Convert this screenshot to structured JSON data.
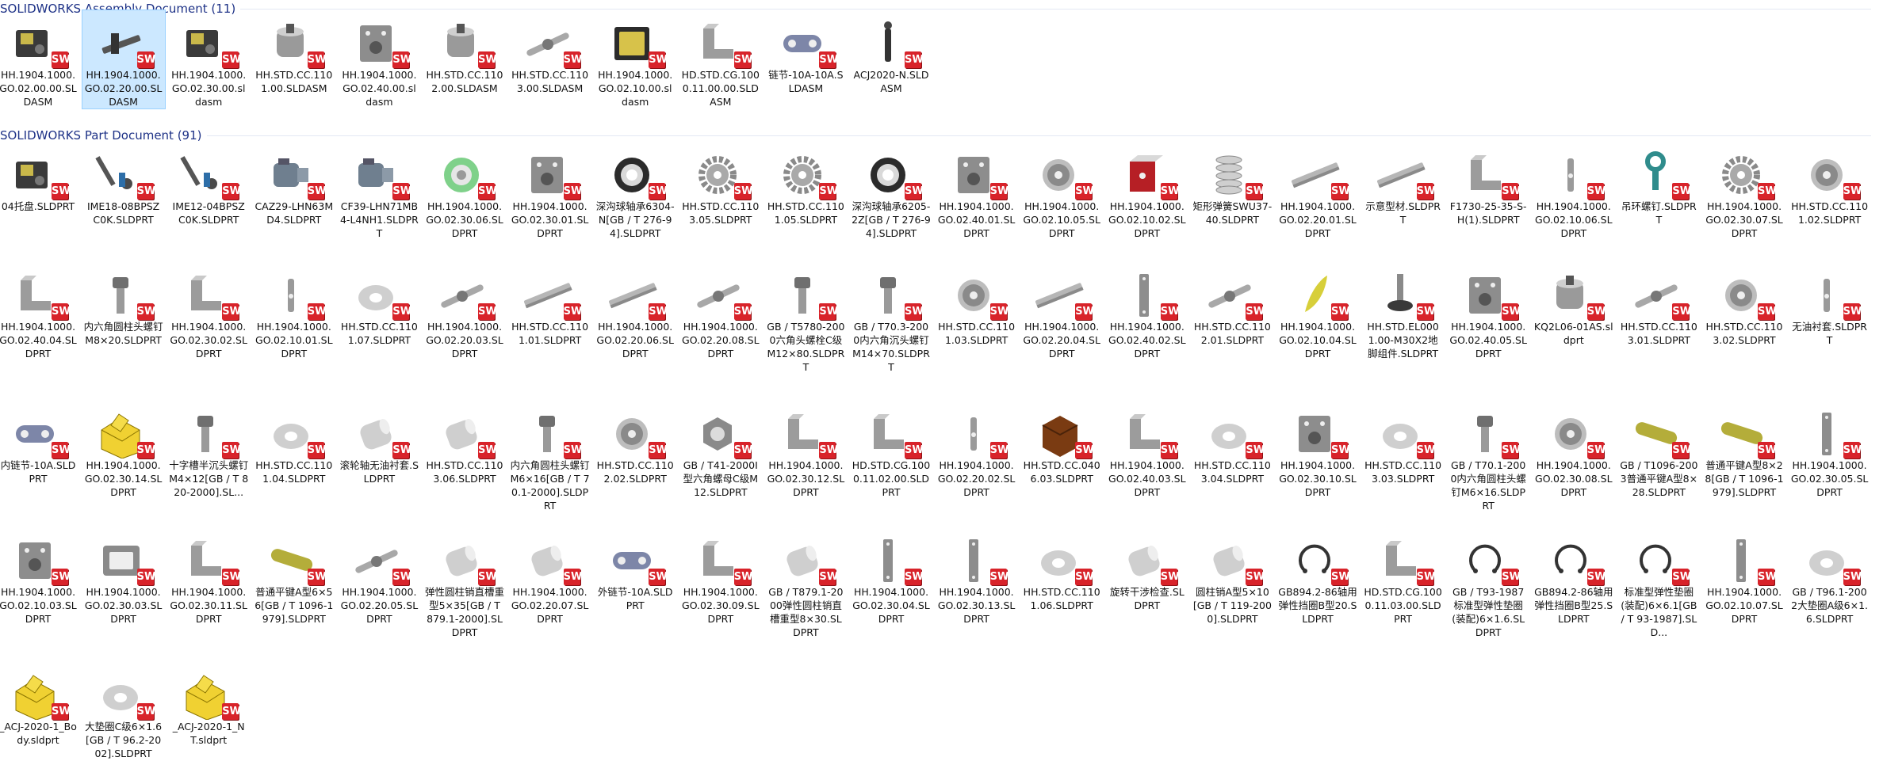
{
  "groups": [
    {
      "title": "SOLIDWORKS Assembly Document (11)",
      "items": [
        {
          "name": "HH.1904.1000.GO.02.00.00.SLDASM",
          "icon": "assembly-dark"
        },
        {
          "name": "HH.1904.1000.GO.02.20.00.SLDASM",
          "icon": "assembly-rail",
          "selected": true
        },
        {
          "name": "HH.1904.1000.GO.02.30.00.sldasm",
          "icon": "assembly-dark"
        },
        {
          "name": "HH.STD.CC.1101.00.SLDASM",
          "icon": "cylinder"
        },
        {
          "name": "HH.1904.1000.GO.02.40.00.sldasm",
          "icon": "plate"
        },
        {
          "name": "HH.STD.CC.1102.00.SLDASM",
          "icon": "cylinder"
        },
        {
          "name": "HH.STD.CC.1103.00.SLDASM",
          "icon": "shaft"
        },
        {
          "name": "HH.1904.1000.GO.02.10.00.sldasm",
          "icon": "assembly-yellow"
        },
        {
          "name": "HD.STD.CG.1000.11.00.00.SLDASM",
          "icon": "bracket"
        },
        {
          "name": "链节-10A-10A.SLDASM",
          "icon": "chainlink"
        },
        {
          "name": "ACJ2020-N.SLDASM",
          "icon": "rod"
        }
      ]
    },
    {
      "title": "SOLIDWORKS Part Document (91)",
      "items": [
        {
          "name": "04托盘.SLDPRT",
          "icon": "assembly-dark"
        },
        {
          "name": "IME18-08BPSZC0K.SLDPRT",
          "icon": "sensor"
        },
        {
          "name": "IME12-04BPSZC0K.SLDPRT",
          "icon": "sensor"
        },
        {
          "name": "CAZ29-LHN63MD4.SLDPRT",
          "icon": "motor"
        },
        {
          "name": "CF39-LHN71MB4-L4NH1.SLDPRT",
          "icon": "motor"
        },
        {
          "name": "HH.1904.1000.GO.02.30.06.SLDPRT",
          "icon": "green-ring"
        },
        {
          "name": "HH.1904.1000.GO.02.30.01.SLDPRT",
          "icon": "plate"
        },
        {
          "name": "深沟球轴承6304-N[GB / T 276-94].SLDPRT",
          "icon": "bearing"
        },
        {
          "name": "HH.STD.CC.1103.05.SLDPRT",
          "icon": "gear"
        },
        {
          "name": "HH.STD.CC.1101.05.SLDPRT",
          "icon": "gear"
        },
        {
          "name": "深沟球轴承6205-2Z[GB / T 276-94].SLDPRT",
          "icon": "bearing"
        },
        {
          "name": "HH.1904.1000.GO.02.40.01.SLDPRT",
          "icon": "plate"
        },
        {
          "name": "HH.1904.1000.GO.02.10.05.SLDPRT",
          "icon": "disc"
        },
        {
          "name": "HH.1904.1000.GO.02.10.02.SLDPRT",
          "icon": "red-bracket"
        },
        {
          "name": "矩形弹簧SWU37-40.SLDPRT",
          "icon": "spring"
        },
        {
          "name": "HH.1904.1000.GO.02.20.01.SLDPRT",
          "icon": "rail"
        },
        {
          "name": "示意型材.SLDPRT",
          "icon": "rail"
        },
        {
          "name": "F1730-25-35-S-H(1).SLDPRT",
          "icon": "bracket"
        },
        {
          "name": "HH.1904.1000.GO.02.10.06.SLDPRT",
          "icon": "pin"
        },
        {
          "name": "吊环螺钉.SLDPRT",
          "icon": "eyebolt"
        },
        {
          "name": "HH.1904.1000.GO.02.30.07.SLDPRT",
          "icon": "gear"
        },
        {
          "name": "HH.STD.CC.1101.02.SLDPRT",
          "icon": "disc"
        },
        {
          "name": "HH.1904.1000.GO.02.40.04.SLDPRT",
          "icon": "bracket"
        },
        {
          "name": "内六角圆柱头螺钉M8×20.SLDPRT",
          "icon": "bolt"
        },
        {
          "name": "HH.1904.1000.GO.02.30.02.SLDPRT",
          "icon": "bracket"
        },
        {
          "name": "HH.1904.1000.GO.02.10.01.SLDPRT",
          "icon": "pin"
        },
        {
          "name": "HH.STD.CC.1101.07.SLDPRT",
          "icon": "washer"
        },
        {
          "name": "HH.1904.1000.GO.02.20.03.SLDPRT",
          "icon": "shaft"
        },
        {
          "name": "HH.STD.CC.1101.01.SLDPRT",
          "icon": "rail"
        },
        {
          "name": "HH.1904.1000.GO.02.20.06.SLDPRT",
          "icon": "rail"
        },
        {
          "name": "HH.1904.1000.GO.02.20.08.SLDPRT",
          "icon": "shaft"
        },
        {
          "name": "GB / T5780-2000六角头螺栓C级M12×80.SLDPRT",
          "icon": "bolt"
        },
        {
          "name": "GB / T70.3-2000内六角沉头螺钉M14×70.SLDPRT",
          "icon": "bolt"
        },
        {
          "name": "HH.STD.CC.1101.03.SLDPRT",
          "icon": "disc"
        },
        {
          "name": "HH.1904.1000.GO.02.20.04.SLDPRT",
          "icon": "rail"
        },
        {
          "name": "HH.1904.1000.GO.02.40.02.SLDPRT",
          "icon": "strip"
        },
        {
          "name": "HH.STD.CC.1102.01.SLDPRT",
          "icon": "shaft"
        },
        {
          "name": "HH.1904.1000.GO.02.10.04.SLDPRT",
          "icon": "yellow-wedge"
        },
        {
          "name": "HH.STD.EL0001.00-M30X2地脚组件.SLDPRT",
          "icon": "foot"
        },
        {
          "name": "HH.1904.1000.GO.02.40.05.SLDPRT",
          "icon": "plate"
        },
        {
          "name": "KQ2L06-01AS.sldprt",
          "icon": "cylinder"
        },
        {
          "name": "HH.STD.CC.1103.01.SLDPRT",
          "icon": "shaft"
        },
        {
          "name": "HH.STD.CC.1103.02.SLDPRT",
          "icon": "disc"
        },
        {
          "name": "无油衬套.SLDPRT",
          "icon": "pin"
        },
        {
          "name": "内链节-10A.SLDPRT",
          "icon": "chainlink"
        },
        {
          "name": "HH.1904.1000.GO.02.30.14.SLDPRT",
          "icon": "yellow-block"
        },
        {
          "name": "十字槽半沉头螺钉M4×12[GB / T 820-2000].SL...",
          "icon": "bolt"
        },
        {
          "name": "HH.STD.CC.1101.04.SLDPRT",
          "icon": "washer"
        },
        {
          "name": "滚轮轴无油衬套.SLDPRT",
          "icon": "tube"
        },
        {
          "name": "HH.STD.CC.1103.06.SLDPRT",
          "icon": "tube"
        },
        {
          "name": "内六角圆柱头螺钉M6×16[GB / T 70.1-2000].SLDPRT",
          "icon": "bolt"
        },
        {
          "name": "HH.STD.CC.1102.02.SLDPRT",
          "icon": "disc"
        },
        {
          "name": "GB / T41-2000I型六角螺母C级M12.SLDPRT",
          "icon": "nut"
        },
        {
          "name": "HH.1904.1000.GO.02.30.12.SLDPRT",
          "icon": "bracket"
        },
        {
          "name": "HD.STD.CG.1000.11.02.00.SLDPRT",
          "icon": "bracket"
        },
        {
          "name": "HH.1904.1000.GO.02.20.02.SLDPRT",
          "icon": "pin"
        },
        {
          "name": "HH.STD.CC.0406.03.SLDPRT",
          "icon": "brown-block"
        },
        {
          "name": "HH.1904.1000.GO.02.40.03.SLDPRT",
          "icon": "bracket"
        },
        {
          "name": "HH.STD.CC.1103.04.SLDPRT",
          "icon": "washer"
        },
        {
          "name": "HH.1904.1000.GO.02.30.10.SLDPRT",
          "icon": "plate"
        },
        {
          "name": "HH.STD.CC.1103.03.SLDPRT",
          "icon": "washer"
        },
        {
          "name": "GB / T70.1-2000内六角圆柱头螺钉M6×16.SLDPRT",
          "icon": "bolt"
        },
        {
          "name": "HH.1904.1000.GO.02.30.08.SLDPRT",
          "icon": "disc"
        },
        {
          "name": "GB / T1096-2003普通平键A型8×28.SLDPRT",
          "icon": "yellow-key"
        },
        {
          "name": "普通平键A型8×28[GB / T 1096-1979].SLDPRT",
          "icon": "yellow-key"
        },
        {
          "name": "HH.1904.1000.GO.02.30.05.SLDPRT",
          "icon": "strip"
        },
        {
          "name": "HH.1904.1000.GO.02.10.03.SLDPRT",
          "icon": "plate"
        },
        {
          "name": "HH.1904.1000.GO.02.30.03.SLDPRT",
          "icon": "frame"
        },
        {
          "name": "HH.1904.1000.GO.02.30.11.SLDPRT",
          "icon": "bracket"
        },
        {
          "name": "普通平键A型6×56[GB / T 1096-1979].SLDPRT",
          "icon": "yellow-key"
        },
        {
          "name": "HH.1904.1000.GO.02.20.05.SLDPRT",
          "icon": "shaft"
        },
        {
          "name": "弹性圆柱销直槽重型5×35[GB / T 879.1-2000].SLDPRT",
          "icon": "tube"
        },
        {
          "name": "HH.1904.1000.GO.02.20.07.SLDPRT",
          "icon": "tube"
        },
        {
          "name": "外链节-10A.SLDPRT",
          "icon": "chainlink"
        },
        {
          "name": "HH.1904.1000.GO.02.30.09.SLDPRT",
          "icon": "bracket"
        },
        {
          "name": "GB / T879.1-2000弹性圆柱销直槽重型8×30.SLDPRT",
          "icon": "tube"
        },
        {
          "name": "HH.1904.1000.GO.02.30.04.SLDPRT",
          "icon": "strip"
        },
        {
          "name": "HH.1904.1000.GO.02.30.13.SLDPRT",
          "icon": "strip"
        },
        {
          "name": "HH.STD.CC.1101.06.SLDPRT",
          "icon": "washer"
        },
        {
          "name": "旋转干涉检查.SLDPRT",
          "icon": "tube"
        },
        {
          "name": "圆柱销A型5×10[GB / T 119-2000].SLDPRT",
          "icon": "tube"
        },
        {
          "name": "GB894.2-86轴用弹性挡圈B型20.SLDPRT",
          "icon": "circlip"
        },
        {
          "name": "HD.STD.CG.1000.11.03.00.SLDPRT",
          "icon": "bracket"
        },
        {
          "name": "GB / T93-1987标准型弹性垫圈(装配)6×1.6.SLDPRT",
          "icon": "circlip"
        },
        {
          "name": "GB894.2-86轴用弹性挡圈B型25.SLDPRT",
          "icon": "circlip"
        },
        {
          "name": "标准型弹性垫圈(装配)6×6.1[GB / T 93-1987].SLD...",
          "icon": "circlip"
        },
        {
          "name": "HH.1904.1000.GO.02.10.07.SLDPRT",
          "icon": "strip"
        },
        {
          "name": "GB / T96.1-2002大垫圈A级6×1.6.SLDPRT",
          "icon": "washer"
        },
        {
          "name": "_ACJ-2020-1_Body.sldprt",
          "icon": "yellow-block"
        },
        {
          "name": "大垫圈C级6×1.6[GB / T 96.2-2002].SLDPRT",
          "icon": "washer"
        },
        {
          "name": "_ACJ-2020-1_NT.sldprt",
          "icon": "yellow-block"
        }
      ]
    }
  ],
  "badge_text": "SW",
  "colors": {
    "accent": "#1e3287",
    "badge": "#d8232a",
    "selection": "#cce8ff"
  }
}
